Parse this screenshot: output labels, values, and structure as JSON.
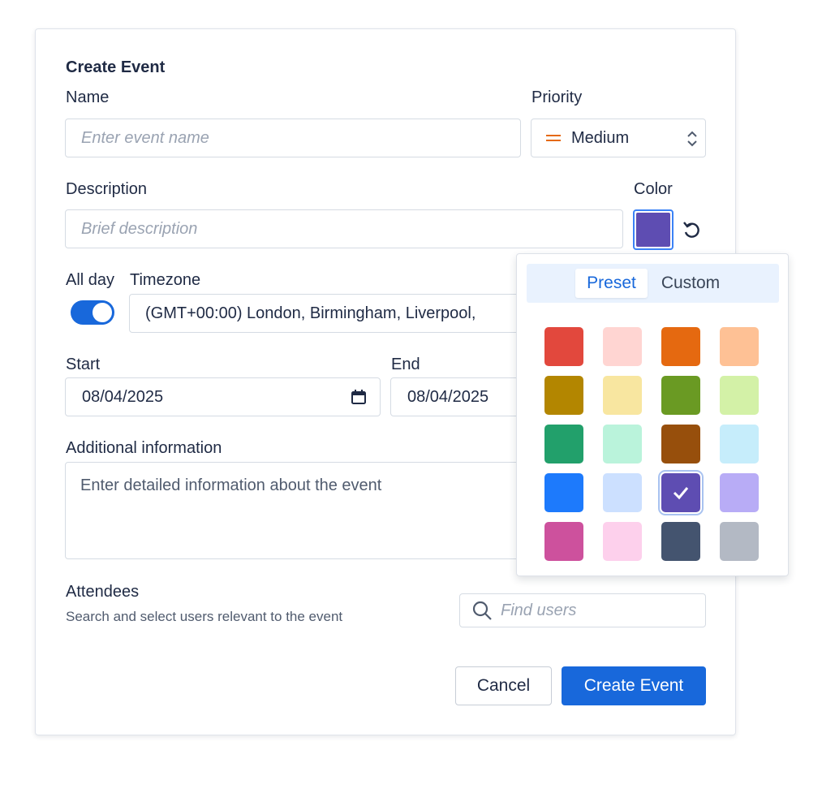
{
  "dialog": {
    "title": "Create Event",
    "name": {
      "label": "Name",
      "placeholder": "Enter event name",
      "value": ""
    },
    "priority": {
      "label": "Priority",
      "value": "Medium",
      "icon": "equals-icon"
    },
    "description": {
      "label": "Description",
      "placeholder": "Brief description",
      "value": ""
    },
    "color": {
      "label": "Color",
      "selected": "#5e4db2",
      "reset_icon": "undo-icon"
    },
    "all_day": {
      "label": "All day",
      "checked": true
    },
    "timezone": {
      "label": "Timezone",
      "value": "(GMT+00:00) London, Birmingham, Liverpool, "
    },
    "start": {
      "label": "Start",
      "value": "08/04/2025"
    },
    "end": {
      "label": "End",
      "value": "08/04/2025"
    },
    "additional": {
      "label": "Additional information",
      "placeholder": "Enter detailed information about the event"
    },
    "attendees": {
      "label": "Attendees",
      "helper": "Search and select users relevant to the event",
      "search_placeholder": "Find users"
    },
    "buttons": {
      "cancel": "Cancel",
      "create": "Create Event"
    }
  },
  "color_picker": {
    "tabs": [
      "Preset",
      "Custom"
    ],
    "active_tab": "Preset",
    "swatches": [
      "#e2483d",
      "#ffd5d2",
      "#e56910",
      "#fec195",
      "#b38600",
      "#f8e6a0",
      "#6a9a23",
      "#d3f1a7",
      "#22a06b",
      "#baf3db",
      "#974f0c",
      "#c6edfb",
      "#1d7afc",
      "#cce0ff",
      "#5e4db2",
      "#b8acf6",
      "#cd519d",
      "#fdd0ec",
      "#44546f",
      "#b3b9c4"
    ],
    "selected_index": 14
  },
  "colors": {
    "accent": "#1868db",
    "text": "#1f2a44"
  }
}
